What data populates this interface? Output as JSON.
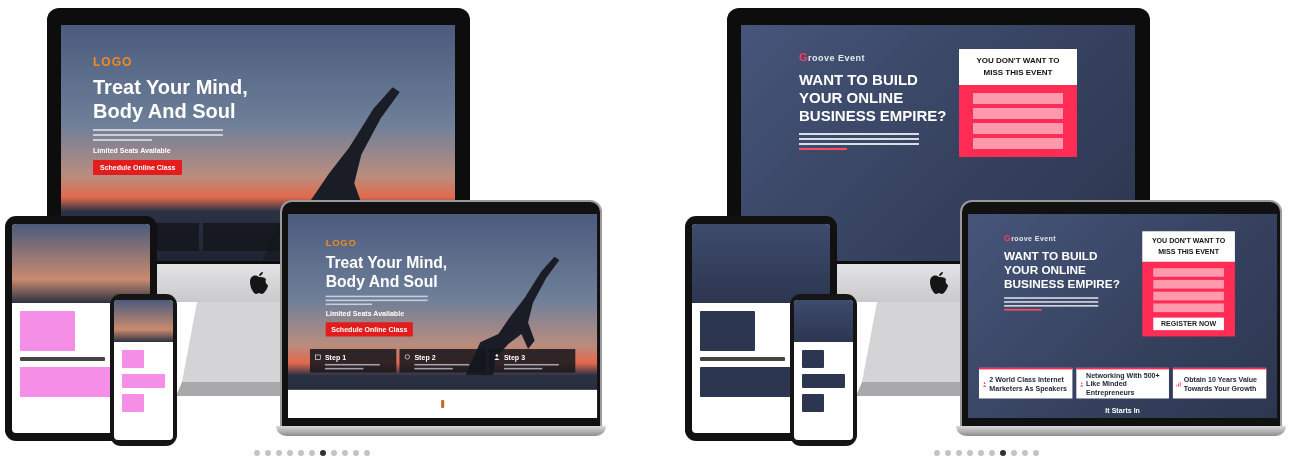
{
  "slides": [
    {
      "kind": "yoga",
      "desktop": {
        "logo": "LOGO",
        "title_lines": [
          "Treat Your Mind,",
          "Body And Soul"
        ],
        "note": "Limited Seats Available",
        "cta": "Schedule Online Class"
      },
      "laptop": {
        "logo": "LOGO",
        "title_lines": [
          "Treat Your Mind,",
          "Body And Soul"
        ],
        "note": "Limited Seats Available",
        "cta": "Schedule Online Class",
        "steps": [
          {
            "title": "Step 1"
          },
          {
            "title": "Step 2"
          },
          {
            "title": "Step 3"
          }
        ]
      },
      "pager": [
        {
          "selected": false
        },
        {
          "selected": false
        },
        {
          "selected": false
        },
        {
          "selected": false
        },
        {
          "selected": false
        },
        {
          "selected": false
        },
        {
          "selected": true
        },
        {
          "selected": false
        },
        {
          "selected": false
        },
        {
          "selected": false
        },
        {
          "selected": false
        }
      ]
    },
    {
      "kind": "event",
      "desktop": {
        "logo": "Groove Event",
        "title_lines": [
          "WANT TO BUILD",
          "YOUR ONLINE",
          "BUSINESS EMPIRE?"
        ],
        "form": {
          "title": "YOU DON'T WANT TO MISS THIS EVENT"
        }
      },
      "laptop": {
        "logo": "Groove Event",
        "title_lines": [
          "WANT TO BUILD",
          "YOUR ONLINE",
          "BUSINESS EMPIRE?"
        ],
        "form": {
          "title": "YOU DON'T WANT TO MISS THIS EVENT",
          "button": "REGISTER NOW"
        },
        "features": [
          {
            "text": "2 World Class Internet Marketers As Speakers"
          },
          {
            "text": "Networking With 500+ Like Minded Entrepreneurs"
          },
          {
            "text": "Obtain 10 Years Value Towards Your Growth"
          }
        ],
        "countdown": "It Starts In"
      },
      "pager": [
        {
          "selected": false
        },
        {
          "selected": false
        },
        {
          "selected": false
        },
        {
          "selected": false
        },
        {
          "selected": false
        },
        {
          "selected": false
        },
        {
          "selected": true
        },
        {
          "selected": false
        },
        {
          "selected": false
        },
        {
          "selected": false
        }
      ]
    }
  ]
}
